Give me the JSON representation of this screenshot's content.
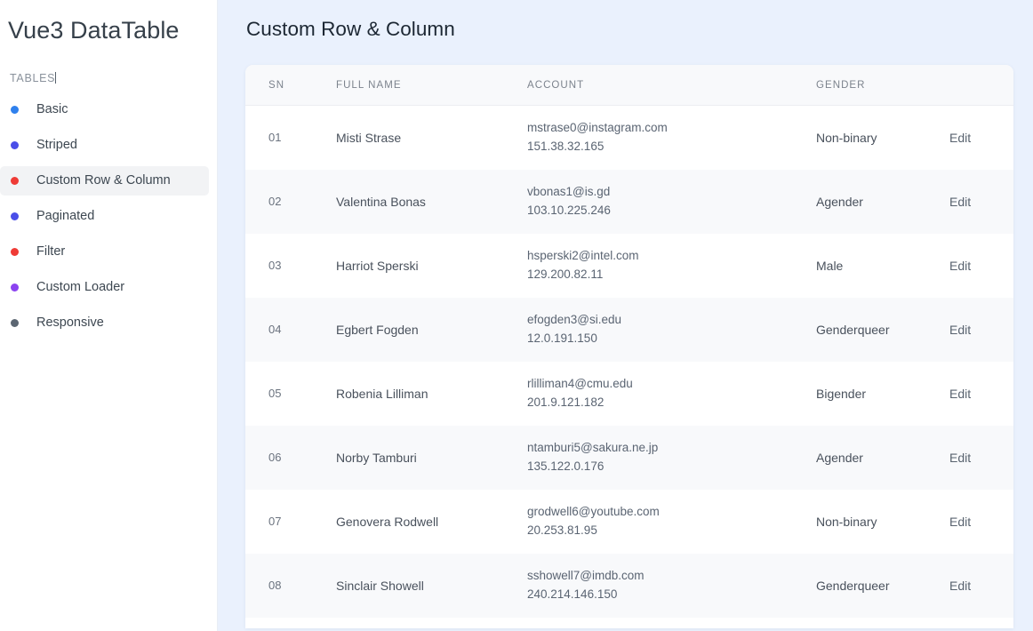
{
  "sidebar": {
    "brand": "Vue3 DataTable",
    "section_label": "TABLES",
    "items": [
      {
        "label": "Basic",
        "dot_color": "#2f80ed",
        "active": false
      },
      {
        "label": "Striped",
        "dot_color": "#4a4ee8",
        "active": false
      },
      {
        "label": "Custom Row & Column",
        "dot_color": "#ef3b36",
        "active": true
      },
      {
        "label": "Paginated",
        "dot_color": "#4a4ee8",
        "active": false
      },
      {
        "label": "Filter",
        "dot_color": "#ef3b36",
        "active": false
      },
      {
        "label": "Custom Loader",
        "dot_color": "#8b43f0",
        "active": false
      },
      {
        "label": "Responsive",
        "dot_color": "#5c6672",
        "active": false
      }
    ]
  },
  "main": {
    "page_title": "Custom Row & Column",
    "table": {
      "columns": [
        "SN",
        "FULL NAME",
        "ACCOUNT",
        "GENDER",
        ""
      ],
      "action_label": "Edit",
      "rows": [
        {
          "sn": "01",
          "name": "Misti Strase",
          "email": "mstrase0@instagram.com",
          "ip": "151.38.32.165",
          "gender": "Non-binary",
          "action": "Edit"
        },
        {
          "sn": "02",
          "name": "Valentina Bonas",
          "email": "vbonas1@is.gd",
          "ip": "103.10.225.246",
          "gender": "Agender",
          "action": "Edit"
        },
        {
          "sn": "03",
          "name": "Harriot Sperski",
          "email": "hsperski2@intel.com",
          "ip": "129.200.82.11",
          "gender": "Male",
          "action": "Edit"
        },
        {
          "sn": "04",
          "name": "Egbert Fogden",
          "email": "efogden3@si.edu",
          "ip": "12.0.191.150",
          "gender": "Genderqueer",
          "action": "Edit"
        },
        {
          "sn": "05",
          "name": "Robenia Lilliman",
          "email": "rlilliman4@cmu.edu",
          "ip": "201.9.121.182",
          "gender": "Bigender",
          "action": "Edit"
        },
        {
          "sn": "06",
          "name": "Norby Tamburi",
          "email": "ntamburi5@sakura.ne.jp",
          "ip": "135.122.0.176",
          "gender": "Agender",
          "action": "Edit"
        },
        {
          "sn": "07",
          "name": "Genovera Rodwell",
          "email": "grodwell6@youtube.com",
          "ip": "20.253.81.95",
          "gender": "Non-binary",
          "action": "Edit"
        },
        {
          "sn": "08",
          "name": "Sinclair Showell",
          "email": "sshowell7@imdb.com",
          "ip": "240.214.146.150",
          "gender": "Genderqueer",
          "action": "Edit"
        }
      ]
    }
  },
  "theme": {
    "page_background": "#eaf1fd",
    "sidebar_background": "#ffffff",
    "card_background": "#ffffff",
    "row_alt_background": "#f8f9fb",
    "header_background": "#f8f9fb",
    "active_nav_background": "#f2f3f5"
  }
}
